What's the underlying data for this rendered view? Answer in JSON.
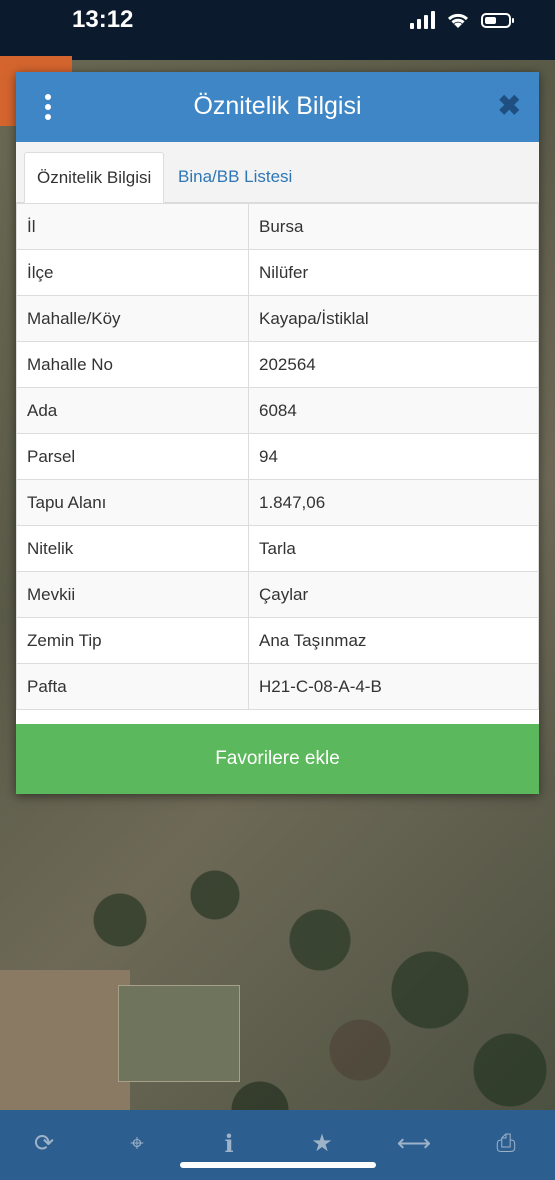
{
  "status_bar": {
    "time": "13:12",
    "signal_bars": 4,
    "battery_level_percent": 50
  },
  "dialog": {
    "title": "Öznitelik Bilgisi",
    "menu_icon": "kebab-menu-icon",
    "close_icon": "close-icon",
    "close_glyph": "✖",
    "tabs": [
      {
        "label": "Öznitelik Bilgisi",
        "active": true
      },
      {
        "label": "Bina/BB Listesi",
        "active": false
      }
    ],
    "rows": [
      {
        "key": "İl",
        "value": "Bursa"
      },
      {
        "key": "İlçe",
        "value": "Nilüfer"
      },
      {
        "key": "Mahalle/Köy",
        "value": "Kayapa/İstiklal"
      },
      {
        "key": "Mahalle No",
        "value": "202564"
      },
      {
        "key": "Ada",
        "value": "6084"
      },
      {
        "key": "Parsel",
        "value": "94"
      },
      {
        "key": "Tapu Alanı",
        "value": "1.847,06"
      },
      {
        "key": "Nitelik",
        "value": "Tarla"
      },
      {
        "key": "Mevkii",
        "value": "Çaylar"
      },
      {
        "key": "Zemin Tip",
        "value": "Ana Taşınmaz"
      },
      {
        "key": "Pafta",
        "value": "H21-C-08-A-4-B"
      }
    ],
    "favorite_button_label": "Favorilere ekle"
  },
  "colors": {
    "header_blue": "#3f86c6",
    "tab_link_blue": "#2e76b6",
    "favorite_green": "#5cb85c",
    "toolbar_blue": "#2c5e8f"
  },
  "toolbar": {
    "items": [
      {
        "name": "refresh-icon",
        "glyph": "⟳"
      },
      {
        "name": "locate-icon",
        "glyph": "⌖"
      },
      {
        "name": "info-icon",
        "glyph": "i"
      },
      {
        "name": "star-icon",
        "glyph": "★"
      },
      {
        "name": "measure-icon",
        "glyph": "⟷"
      },
      {
        "name": "print-icon",
        "glyph": "⎙"
      }
    ]
  }
}
